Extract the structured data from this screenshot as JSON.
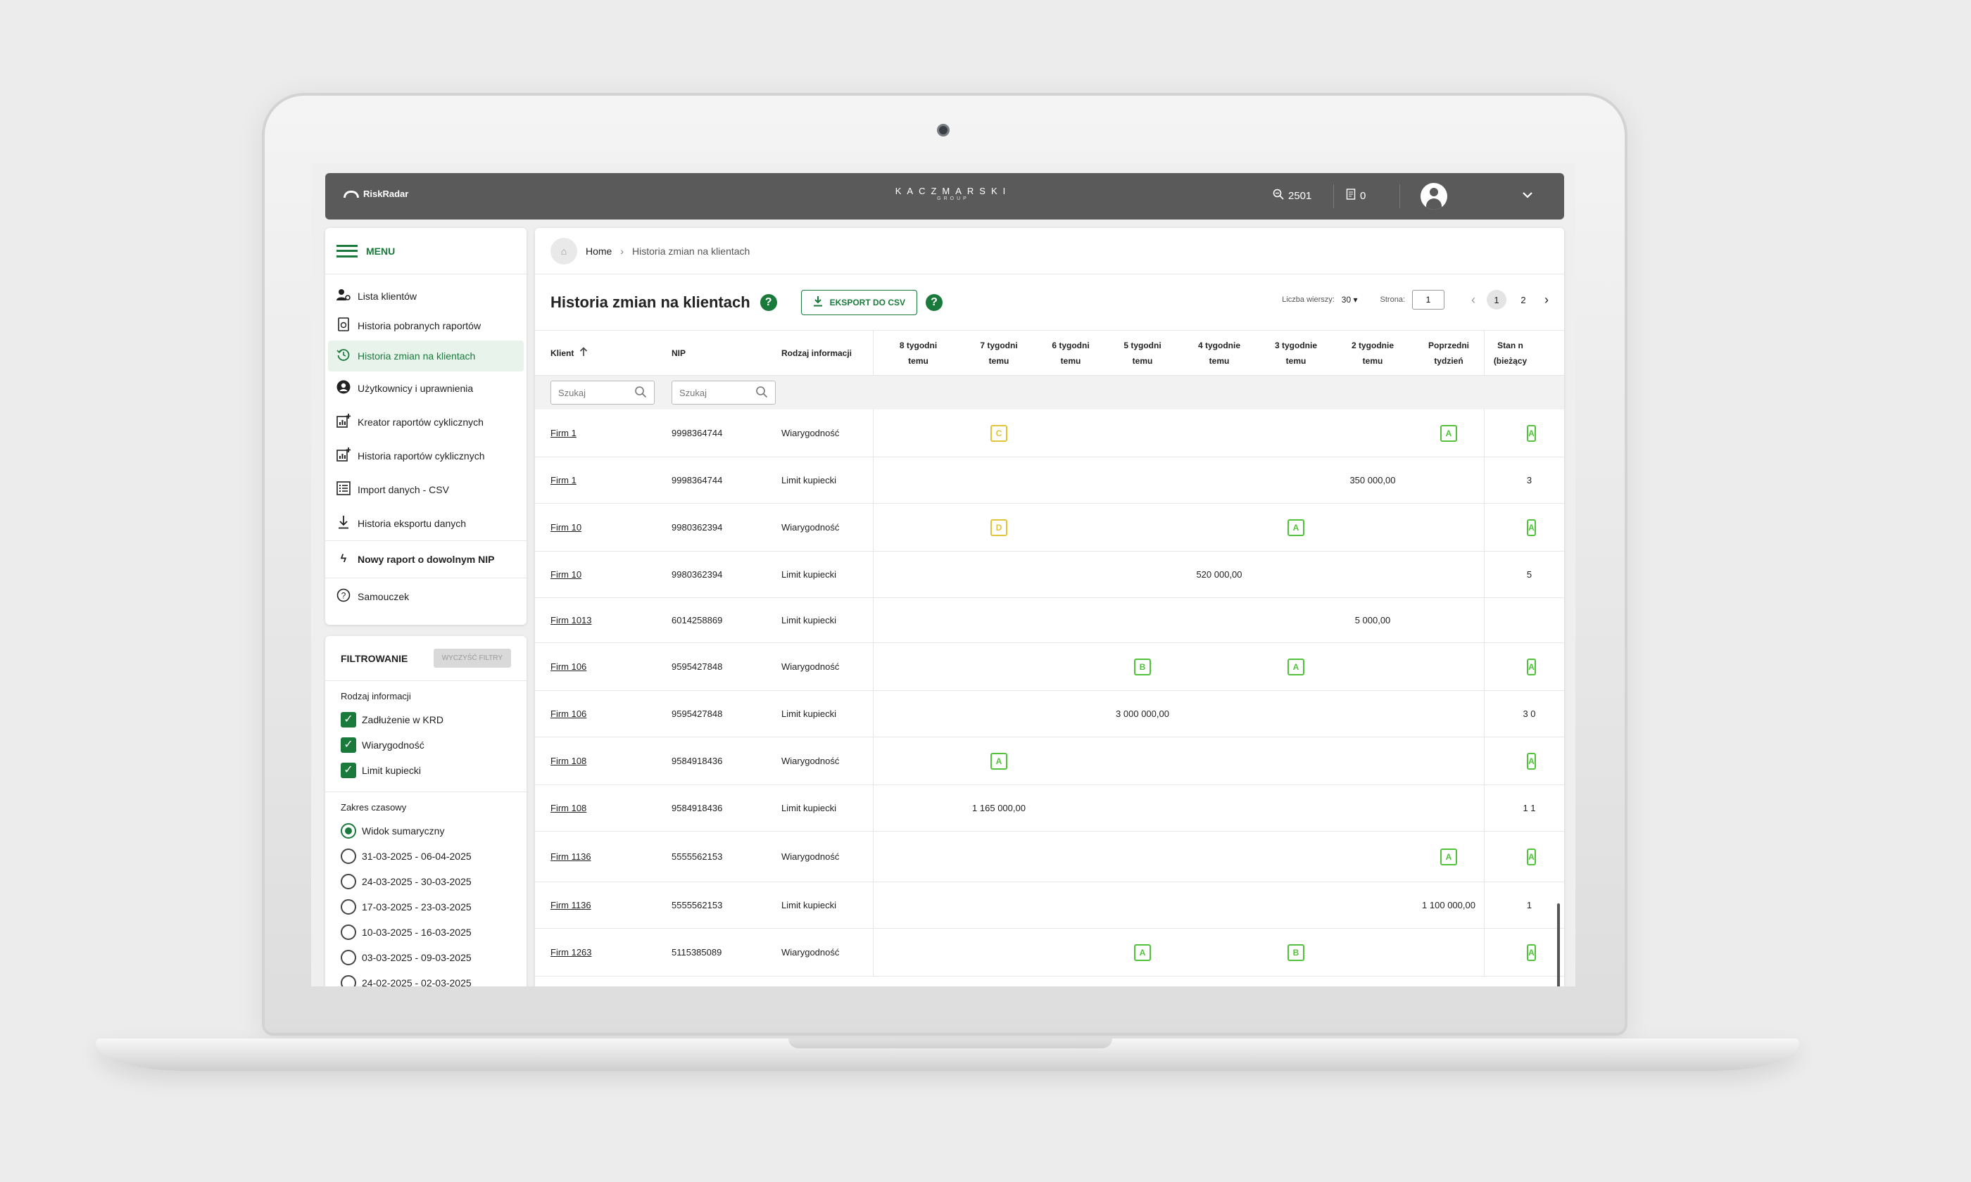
{
  "header": {
    "logo_text": "RiskRadar",
    "brand_main": "KACZMARSKI",
    "brand_sub": "GROUP",
    "search_count": "2501",
    "doc_count": "0"
  },
  "menu": {
    "title": "MENU",
    "items": [
      {
        "label": "Lista klientów",
        "icon": "users-gear-icon"
      },
      {
        "label": "Historia pobranych raportów",
        "icon": "report-history-icon"
      },
      {
        "label": "Historia zmian na klientach",
        "icon": "history-icon",
        "active": true
      },
      {
        "label": "Użytkownicy i uprawnienia",
        "icon": "user-circle-icon"
      },
      {
        "label": "Kreator raportów cyklicznych",
        "icon": "chart-add-icon"
      },
      {
        "label": "Historia raportów cyklicznych",
        "icon": "chart-add-icon"
      },
      {
        "label": "Import danych - CSV",
        "icon": "list-icon"
      },
      {
        "label": "Historia eksportu danych",
        "icon": "download-icon"
      }
    ],
    "new_report": "Nowy raport o dowolnym NIP",
    "tutorial": "Samouczek"
  },
  "filters": {
    "title": "FILTROWANIE",
    "clear_label": "WYCZYŚĆ FILTRY",
    "info_type_label": "Rodzaj informacji",
    "info_types": [
      "Zadłużenie w KRD",
      "Wiarygodność",
      "Limit kupiecki"
    ],
    "range_label": "Zakres czasowy",
    "ranges": [
      "Widok sumaryczny",
      "31-03-2025 - 06-04-2025",
      "24-03-2025 - 30-03-2025",
      "17-03-2025 - 23-03-2025",
      "10-03-2025 - 16-03-2025",
      "03-03-2025 - 09-03-2025",
      "24-02-2025 - 02-03-2025"
    ],
    "selected_range": "Widok sumaryczny"
  },
  "breadcrumb": {
    "home": "Home",
    "current": "Historia zmian na klientach"
  },
  "page": {
    "title": "Historia zmian na klientach",
    "export_label": "EKSPORT DO CSV",
    "rows_label": "Liczba wierszy:",
    "rows_value": "30",
    "page_label": "Strona:",
    "page_value": "1",
    "pages": [
      "1",
      "2"
    ],
    "current_page": "1"
  },
  "table": {
    "columns": {
      "client": "Klient",
      "nip": "NIP",
      "info": "Rodzaj informacji",
      "weeks": [
        "8 tygodni\ntemu",
        "7 tygodni\ntemu",
        "6 tygodni\ntemu",
        "5 tygodni\ntemu",
        "4 tygodnie\ntemu",
        "3 tygodnie\ntemu",
        "2 tygodnie\ntemu",
        "Poprzedni\ntydzień",
        "Stan n\n(bieżący"
      ]
    },
    "search_placeholder": "Szukaj",
    "rows": [
      {
        "client": "Firm 1",
        "nip": "9998364744",
        "info": "Wiarygodność",
        "cells": [
          "",
          {
            "b": "C"
          },
          "",
          "",
          "",
          "",
          "",
          {
            "b": "A"
          },
          {
            "b": "A"
          }
        ]
      },
      {
        "client": "Firm 1",
        "nip": "9998364744",
        "info": "Limit kupiecki",
        "cells": [
          "",
          "",
          "",
          "",
          "",
          "",
          "350 000,00",
          "",
          "3"
        ]
      },
      {
        "client": "Firm 10",
        "nip": "9980362394",
        "info": "Wiarygodność",
        "cells": [
          "",
          {
            "b": "D"
          },
          "",
          "",
          "",
          {
            "b": "A"
          },
          "",
          "",
          {
            "b": "A"
          }
        ]
      },
      {
        "client": "Firm 10",
        "nip": "9980362394",
        "info": "Limit kupiecki",
        "cells": [
          "",
          "",
          "",
          "",
          "520 000,00",
          "",
          "",
          "",
          "5"
        ]
      },
      {
        "client": "Firm 1013",
        "nip": "6014258869",
        "info": "Limit kupiecki",
        "cells": [
          "",
          "",
          "",
          "",
          "",
          "",
          "5 000,00",
          "",
          ""
        ]
      },
      {
        "client": "Firm 106",
        "nip": "9595427848",
        "info": "Wiarygodność",
        "cells": [
          "",
          "",
          "",
          {
            "b": "B"
          },
          "",
          {
            "b": "A"
          },
          "",
          "",
          {
            "b": "A"
          }
        ]
      },
      {
        "client": "Firm 106",
        "nip": "9595427848",
        "info": "Limit kupiecki",
        "cells": [
          "",
          "",
          "",
          "3 000 000,00",
          "",
          "",
          "",
          "",
          "3 0"
        ]
      },
      {
        "client": "Firm 108",
        "nip": "9584918436",
        "info": "Wiarygodność",
        "cells": [
          "",
          {
            "b": "A"
          },
          "",
          "",
          "",
          "",
          "",
          "",
          {
            "b": "A"
          }
        ]
      },
      {
        "client": "Firm 108",
        "nip": "9584918436",
        "info": "Limit kupiecki",
        "cells": [
          "",
          "1 165 000,00",
          "",
          "",
          "",
          "",
          "",
          "",
          "1 1"
        ]
      },
      {
        "client": "Firm 1136",
        "nip": "5555562153",
        "info": "Wiarygodność",
        "cells": [
          "",
          "",
          "",
          "",
          "",
          "",
          "",
          {
            "b": "A"
          },
          {
            "b": "A"
          }
        ]
      },
      {
        "client": "Firm 1136",
        "nip": "5555562153",
        "info": "Limit kupiecki",
        "cells": [
          "",
          "",
          "",
          "",
          "",
          "",
          "",
          "1 100 000,00",
          "1"
        ]
      },
      {
        "client": "Firm 1263",
        "nip": "5115385089",
        "info": "Wiarygodność",
        "cells": [
          "",
          "",
          "",
          {
            "b": "A"
          },
          "",
          {
            "b": "B"
          },
          "",
          "",
          {
            "b": "A"
          }
        ]
      }
    ]
  },
  "colors": {
    "accent": "#1a7a3c",
    "badge_green": "#52c23d",
    "badge_yellow": "#e0c43a",
    "header_bg": "#5a5a5a"
  }
}
